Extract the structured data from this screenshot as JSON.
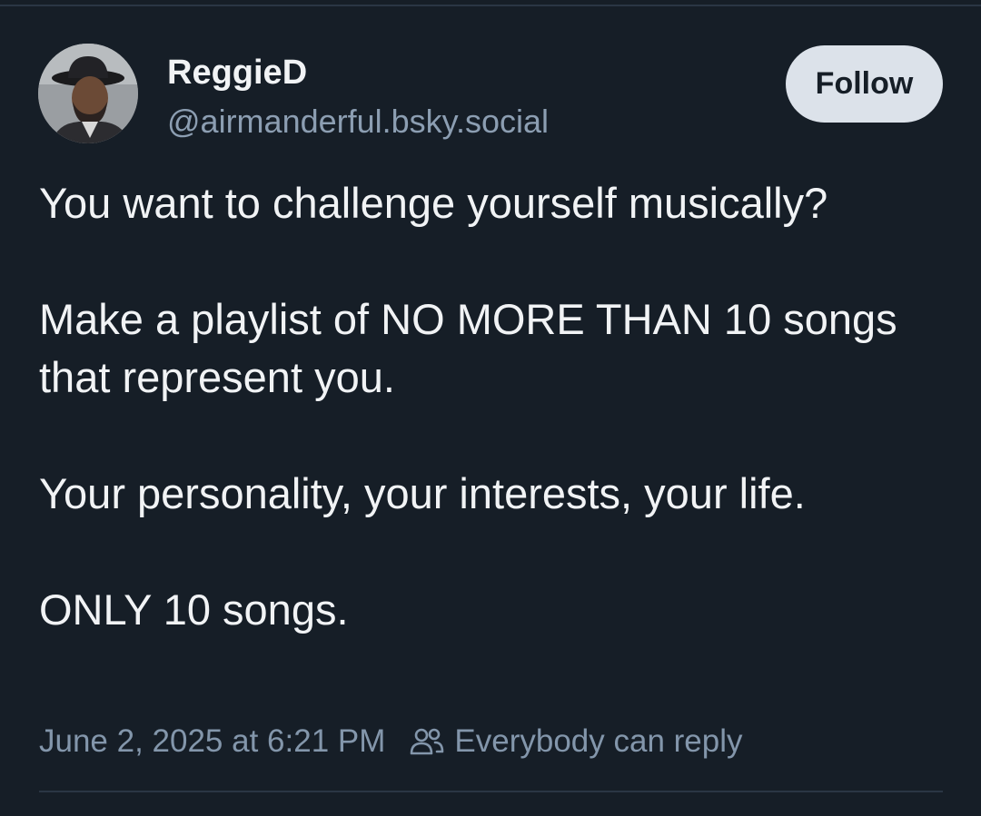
{
  "author": {
    "display_name": "ReggieD",
    "handle": "@airmanderful.bsky.social"
  },
  "follow_button": {
    "label": "Follow"
  },
  "post": {
    "paragraphs": [
      "You want to challenge yourself musically?",
      "Make a playlist of NO MORE THAN 10 songs that represent you.",
      "Your personality, your interests, your life.",
      "ONLY 10 songs."
    ],
    "timestamp": "June 2, 2025 at 6:21 PM",
    "reply_setting": "Everybody can reply"
  },
  "icons": {
    "reply_setting_icon": "people-icon"
  },
  "colors": {
    "background": "#161e27",
    "text_primary": "#f1f3f5",
    "text_secondary": "#8c9eb2",
    "follow_button_bg": "#dce2ea"
  }
}
